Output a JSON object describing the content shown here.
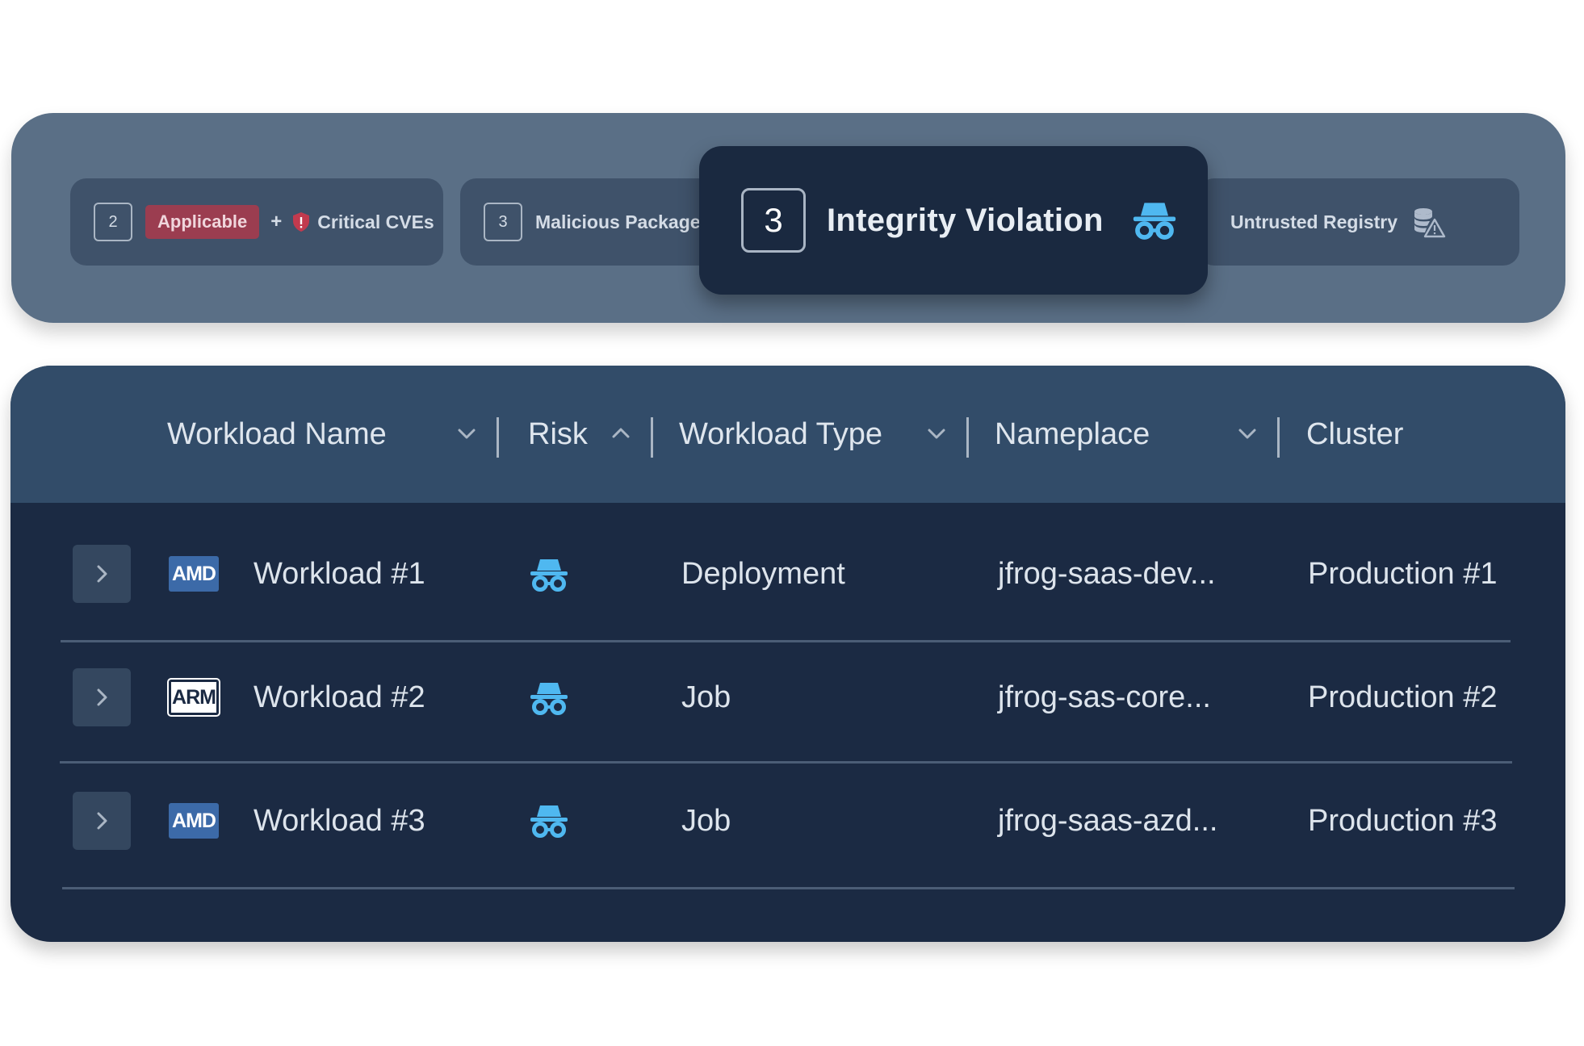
{
  "filters": {
    "applicable": {
      "count": "2",
      "badge": "Applicable",
      "plus": "+",
      "label": "Critical CVEs"
    },
    "malicious": {
      "count": "3",
      "label": "Malicious Package"
    },
    "integrity": {
      "count": "3",
      "label": "Integrity Violation",
      "icon": "spy-icon"
    },
    "untrusted": {
      "label": "Untrusted Registry",
      "icon": "database-warning-icon"
    }
  },
  "table": {
    "columns": [
      {
        "label": "Workload Name",
        "sort": "chevron-down"
      },
      {
        "label": "Risk",
        "sort": "chevron-up"
      },
      {
        "label": "Workload Type",
        "sort": "chevron-down"
      },
      {
        "label": "Nameplace",
        "sort": "chevron-down"
      },
      {
        "label": "Cluster"
      }
    ],
    "rows": [
      {
        "arch": "AMD",
        "name": "Workload #1",
        "risk_icon": "spy-icon",
        "type": "Deployment",
        "namespace": "jfrog-saas-dev...",
        "cluster": "Production #1"
      },
      {
        "arch": "ARM",
        "name": "Workload #2",
        "risk_icon": "spy-icon",
        "type": "Job",
        "namespace": "jfrog-sas-core...",
        "cluster": "Production #2"
      },
      {
        "arch": "AMD",
        "name": "Workload #3",
        "risk_icon": "spy-icon",
        "type": "Job",
        "namespace": "jfrog-saas-azd...",
        "cluster": "Production #3"
      }
    ]
  },
  "colors": {
    "filter_panel_bg": "#5a6f86",
    "chip_bg": "#3f526a",
    "active_chip_bg": "#1a2940",
    "table_header_bg": "#324c69",
    "table_body_bg": "#1b2a43",
    "applicable_badge": "#9b3d50",
    "risk_icon": "#4fb8f0",
    "amd_badge": "#3c6aa8"
  }
}
